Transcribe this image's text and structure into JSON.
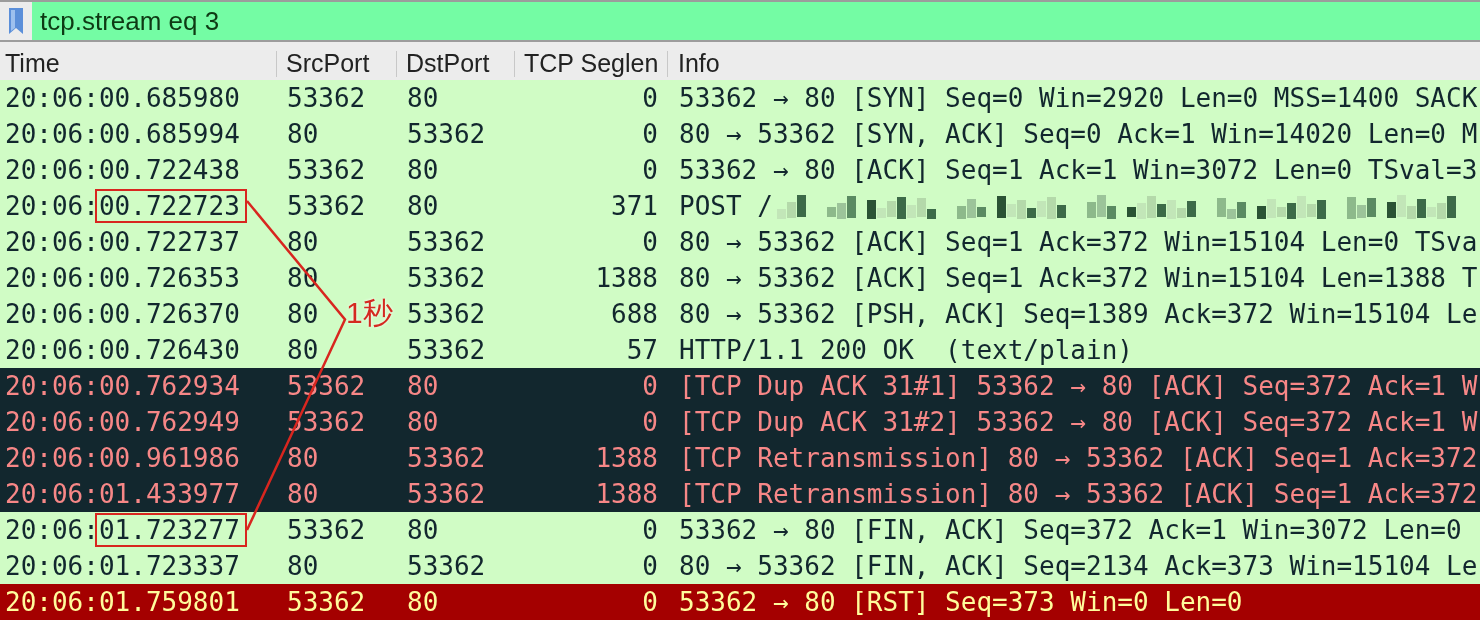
{
  "filter_bar": {
    "value": "tcp.stream eq 3"
  },
  "columns": [
    "Time",
    "SrcPort",
    "DstPort",
    "TCP Seglen",
    "Info"
  ],
  "rows": [
    {
      "time": "20:06:00.685980",
      "src_port": "53362",
      "dst_port": "80",
      "seglen": "0",
      "info": "53362 → 80 [SYN] Seq=0 Win=2920 Len=0 MSS=1400 SACK",
      "kind": "normal",
      "boxed": false,
      "redacted": false
    },
    {
      "time": "20:06:00.685994",
      "src_port": "80",
      "dst_port": "53362",
      "seglen": "0",
      "info": "80 → 53362 [SYN, ACK] Seq=0 Ack=1 Win=14020 Len=0 M",
      "kind": "normal",
      "boxed": false,
      "redacted": false
    },
    {
      "time": "20:06:00.722438",
      "src_port": "53362",
      "dst_port": "80",
      "seglen": "0",
      "info": "53362 → 80 [ACK] Seq=1 Ack=1 Win=3072 Len=0 TSval=3",
      "kind": "normal",
      "boxed": false,
      "redacted": false
    },
    {
      "time": "20:06:00.722723",
      "src_port": "53362",
      "dst_port": "80",
      "seglen": "371",
      "info": "POST /",
      "kind": "normal",
      "boxed": true,
      "redacted": true
    },
    {
      "time": "20:06:00.722737",
      "src_port": "80",
      "dst_port": "53362",
      "seglen": "0",
      "info": "80 → 53362 [ACK] Seq=1 Ack=372 Win=15104 Len=0 TSva",
      "kind": "normal",
      "boxed": false,
      "redacted": false
    },
    {
      "time": "20:06:00.726353",
      "src_port": "80",
      "dst_port": "53362",
      "seglen": "1388",
      "info": "80 → 53362 [ACK] Seq=1 Ack=372 Win=15104 Len=1388 T",
      "kind": "normal",
      "boxed": false,
      "redacted": false
    },
    {
      "time": "20:06:00.726370",
      "src_port": "80",
      "dst_port": "53362",
      "seglen": "688",
      "info": "80 → 53362 [PSH, ACK] Seq=1389 Ack=372 Win=15104 Le",
      "kind": "normal",
      "boxed": false,
      "redacted": false
    },
    {
      "time": "20:06:00.726430",
      "src_port": "80",
      "dst_port": "53362",
      "seglen": "57",
      "info": "HTTP/1.1 200 OK  (text/plain)",
      "kind": "normal",
      "boxed": false,
      "redacted": false
    },
    {
      "time": "20:06:00.762934",
      "src_port": "53362",
      "dst_port": "80",
      "seglen": "0",
      "info": "[TCP Dup ACK 31#1] 53362 → 80 [ACK] Seq=372 Ack=1 W",
      "kind": "bad",
      "boxed": false,
      "redacted": false
    },
    {
      "time": "20:06:00.762949",
      "src_port": "53362",
      "dst_port": "80",
      "seglen": "0",
      "info": "[TCP Dup ACK 31#2] 53362 → 80 [ACK] Seq=372 Ack=1 W",
      "kind": "bad",
      "boxed": false,
      "redacted": false
    },
    {
      "time": "20:06:00.961986",
      "src_port": "80",
      "dst_port": "53362",
      "seglen": "1388",
      "info": "[TCP Retransmission] 80 → 53362 [ACK] Seq=1 Ack=372",
      "kind": "bad",
      "boxed": false,
      "redacted": false
    },
    {
      "time": "20:06:01.433977",
      "src_port": "80",
      "dst_port": "53362",
      "seglen": "1388",
      "info": "[TCP Retransmission] 80 → 53362 [ACK] Seq=1 Ack=372",
      "kind": "bad",
      "boxed": false,
      "redacted": false
    },
    {
      "time": "20:06:01.723277",
      "src_port": "53362",
      "dst_port": "80",
      "seglen": "0",
      "info": "53362 → 80 [FIN, ACK] Seq=372 Ack=1 Win=3072 Len=0",
      "kind": "normal",
      "boxed": true,
      "redacted": false
    },
    {
      "time": "20:06:01.723337",
      "src_port": "80",
      "dst_port": "53362",
      "seglen": "0",
      "info": "80 → 53362 [FIN, ACK] Seq=2134 Ack=373 Win=15104 Le",
      "kind": "normal",
      "boxed": false,
      "redacted": false
    },
    {
      "time": "20:06:01.759801",
      "src_port": "53362",
      "dst_port": "80",
      "seglen": "0",
      "info": "53362 → 80 [RST] Seq=373 Win=0 Len=0",
      "kind": "reset",
      "boxed": false,
      "redacted": false
    }
  ],
  "annotation": {
    "label": "1秒"
  }
}
